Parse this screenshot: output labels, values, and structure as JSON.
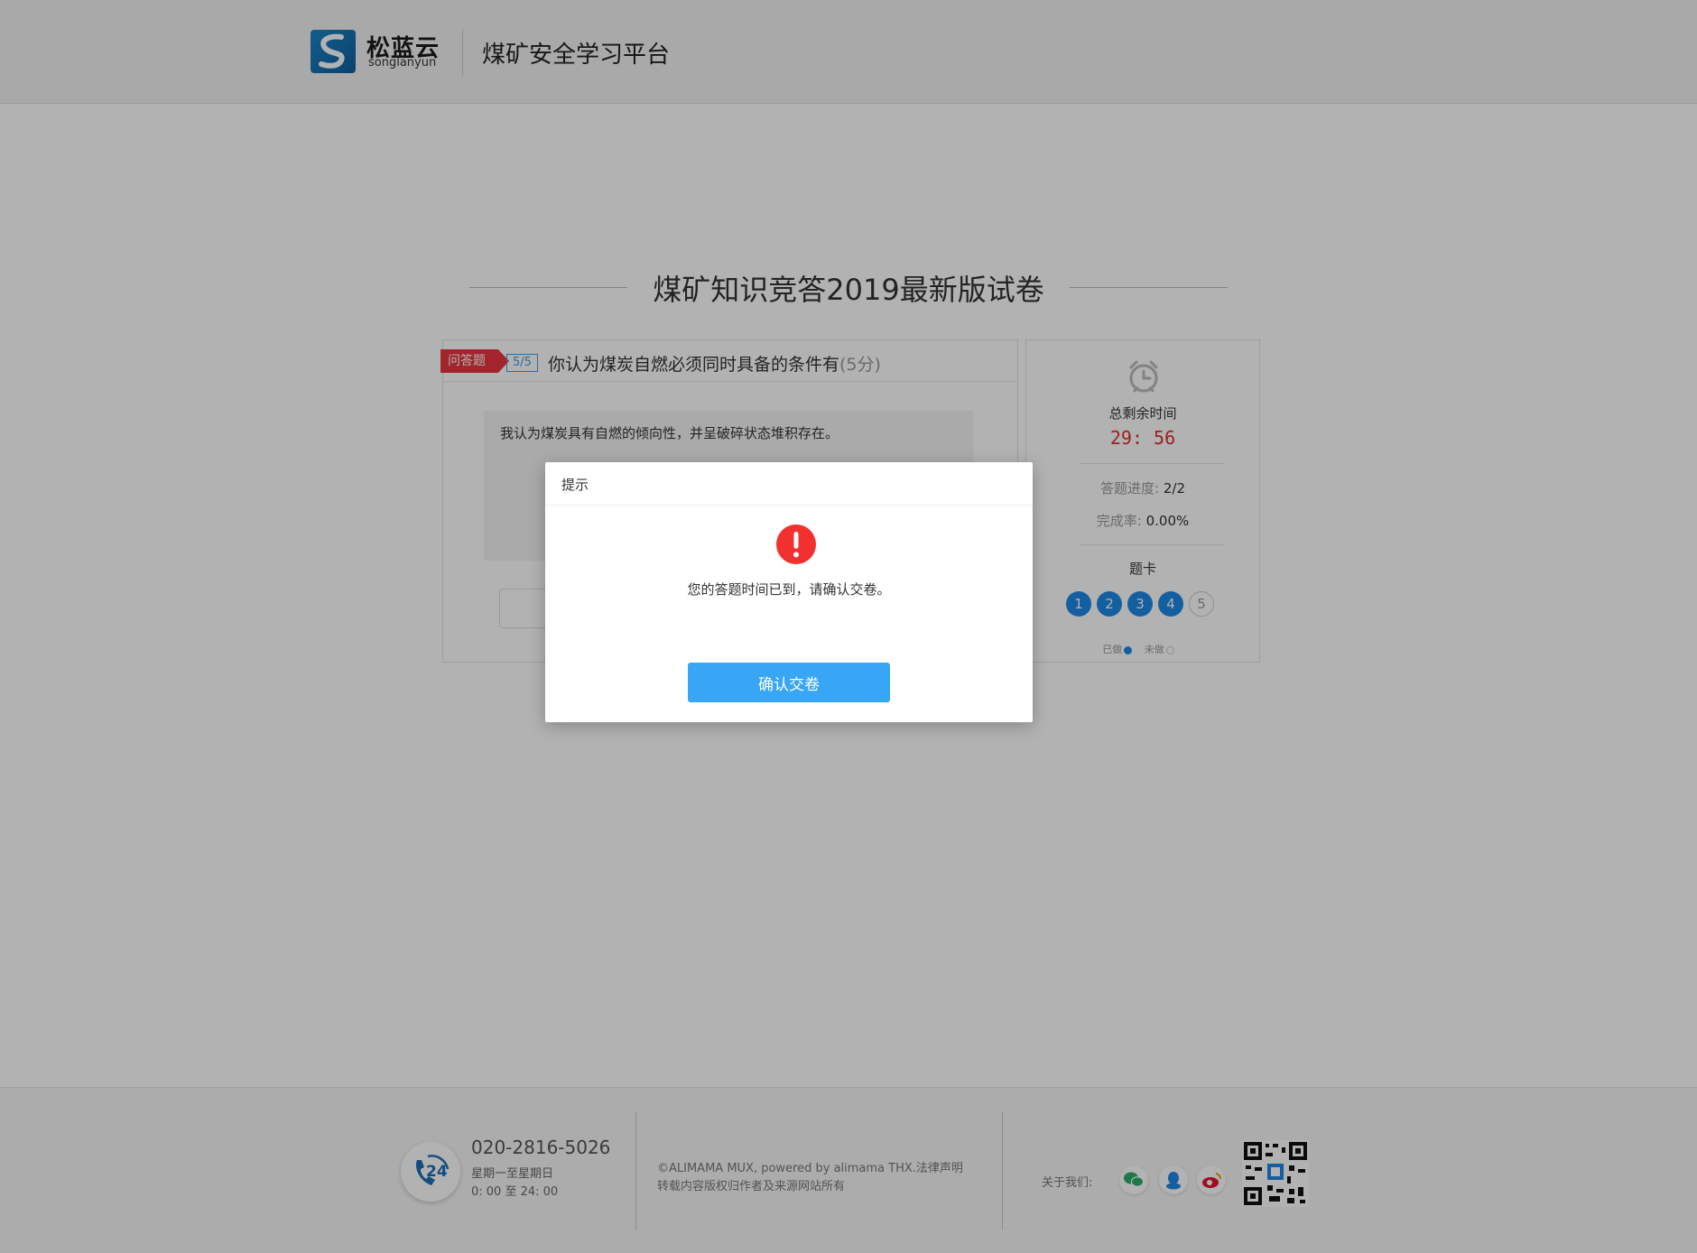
{
  "header": {
    "brand_cn": "松蓝云",
    "brand_en": "songlanyun",
    "platform_title": "煤矿安全学习平台"
  },
  "exam": {
    "title": "煤矿知识竞答2019最新版试卷"
  },
  "question": {
    "type_label": "问答题",
    "number": "5/5",
    "text": "你认为煤炭自燃必须同时具备的条件有",
    "score": "(5分)",
    "answer": "我认为煤炭具有自燃的倾向性，并呈破碎状态堆积存在。"
  },
  "sidebar": {
    "remain_label": "总剩余时间",
    "remain_time": "29: 56",
    "progress_label": "答题进度:",
    "progress_value": "2/2",
    "completion_label": "完成率:",
    "completion_value": "0.00%",
    "card_label": "题卡",
    "card_items": [
      {
        "label": "1",
        "state": "done"
      },
      {
        "label": "2",
        "state": "done"
      },
      {
        "label": "3",
        "state": "done"
      },
      {
        "label": "4",
        "state": "done"
      },
      {
        "label": "5",
        "state": "todo"
      }
    ],
    "legend_done": "已做",
    "legend_todo": "未做"
  },
  "modal": {
    "title": "提示",
    "message": "您的答题时间已到，请确认交卷。",
    "confirm_label": "确认交卷"
  },
  "footer": {
    "phone": "020-2816-5026",
    "hours_days": "星期一至星期日",
    "hours_time": "0: 00 至 24: 00",
    "copyright": "©ALIMAMA MUX, powered by alimama THX.法律声明",
    "copyright_note": "转载内容版权归作者及来源网站所有",
    "about_label": "关于我们:",
    "phone_badge_text": "24"
  },
  "colors": {
    "accent_blue": "#1e88e5",
    "button_blue": "#38a6f5",
    "alert_red": "#e52d2d",
    "question_tag_red": "#e8363f"
  }
}
